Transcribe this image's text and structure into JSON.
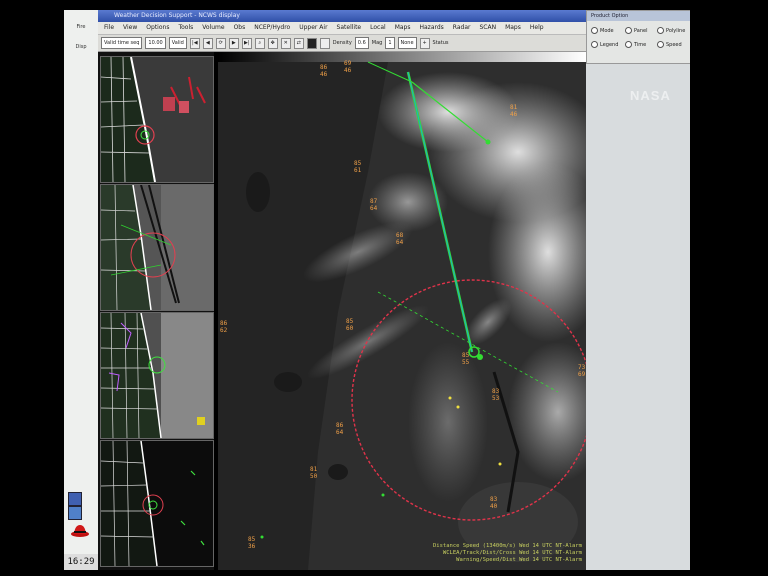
{
  "taskbar": {
    "clock": "16:29",
    "items": [
      "Fire",
      "Disp"
    ]
  },
  "window": {
    "title": "Weather Decision Support - NCWS display",
    "menu": [
      "File",
      "View",
      "Options",
      "Tools",
      "Volume",
      "Obs",
      "NCEP/Hydro",
      "Upper Air",
      "Satellite",
      "Local",
      "Maps",
      "Hazards",
      "Radar",
      "SCAN",
      "Maps",
      "Help"
    ],
    "toolbar": {
      "frame_select": "Valid time seq",
      "frame_count": "10.00",
      "load_mode": "Valid",
      "density": "Density",
      "density_value": "0.6",
      "mag": "Mag",
      "mag_value": "1",
      "none_select": "None",
      "status": "Status"
    }
  },
  "side_panel": {
    "title": "Product Option",
    "options": [
      "Mode",
      "Panel",
      "Polyline",
      "Legend",
      "Time",
      "Speed"
    ]
  },
  "watermark": "NASA",
  "map": {
    "readout_lines": [
      "Distance Speed (13400m/s)  Wed 14 UTC  NT-Alarm",
      "WCLEA/Track/Dist/Cross  Wed 14 UTC  NT-Alarm",
      "Warning/Speed/Dist  Wed 14 UTC  NT-Alarm"
    ],
    "station_labels": [
      {
        "t": "86",
        "b": "46"
      },
      {
        "t": "85",
        "b": "61"
      },
      {
        "t": "87",
        "b": "64"
      },
      {
        "t": "68",
        "b": "64"
      },
      {
        "t": "86",
        "b": "62"
      },
      {
        "t": "85",
        "b": "60"
      },
      {
        "t": "85",
        "b": "55"
      },
      {
        "t": "86",
        "b": "64"
      },
      {
        "t": "81",
        "b": "50"
      },
      {
        "t": "83",
        "b": "40"
      },
      {
        "t": "85",
        "b": "36"
      },
      {
        "t": "73",
        "b": "69"
      },
      {
        "t": "83",
        "b": "53"
      },
      {
        "t": "81",
        "b": "46"
      },
      {
        "t": "69",
        "b": "46"
      }
    ]
  },
  "colors": {
    "range_ring": "#e0334a",
    "track_line": "#33dd33",
    "station_text": "#f0a048",
    "readout_text": "#c8d060"
  }
}
